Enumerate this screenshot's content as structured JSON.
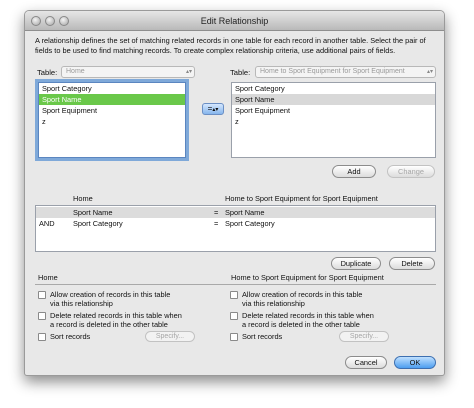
{
  "window": {
    "title": "Edit Relationship"
  },
  "description": "A relationship defines the set of matching related records in one table for each record in another table. Select the pair of fields to be used to find matching records. To create complex relationship criteria, use additional pairs of fields.",
  "left_table": {
    "label": "Table:",
    "selected": "Home",
    "fields": [
      "Sport Category",
      "Sport Name",
      "Sport Equipment",
      "z"
    ],
    "selected_field": "Sport Name"
  },
  "right_table": {
    "label": "Table:",
    "selected": "Home to Sport Equipment for Sport Equipment",
    "fields": [
      "Sport Category",
      "Sport Name",
      "Sport Equipment",
      "z"
    ],
    "selected_field": "Sport Name"
  },
  "operator": {
    "value": "=",
    "arrow": "chevron-updown"
  },
  "buttons": {
    "add": "Add",
    "change": "Change",
    "duplicate": "Duplicate",
    "delete": "Delete",
    "cancel": "Cancel",
    "ok": "OK",
    "specify": "Specify..."
  },
  "criteria": {
    "headers": {
      "left": "Home",
      "right": "Home to Sport Equipment for Sport Equipment"
    },
    "rows": [
      {
        "conj": "",
        "left": "Sport Name",
        "op": "=",
        "right": "Sport Name"
      },
      {
        "conj": "AND",
        "left": "Sport Category",
        "op": "=",
        "right": "Sport Category"
      }
    ]
  },
  "options": {
    "left_title": "Home",
    "right_title": "Home to Sport Equipment for Sport Equipment",
    "allow_line1": "Allow creation of records in this table",
    "allow_line2": "via this relationship",
    "delete_line1": "Delete related records in this table when",
    "delete_line2": "a record is deleted in the other table",
    "sort": "Sort records"
  }
}
